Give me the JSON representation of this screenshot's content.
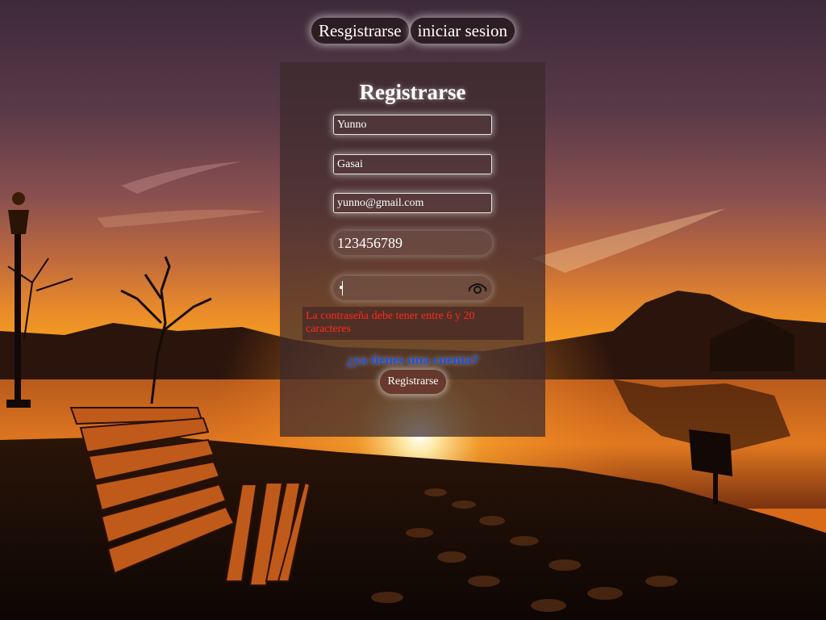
{
  "nav": {
    "register_label": "Resgistrarse",
    "login_label": "iniciar sesion"
  },
  "form": {
    "title": "Registrarse",
    "first_name_value": "Yunno",
    "last_name_value": "Gasai",
    "email_value": "yunno@gmail.com",
    "phone_value": "123456789",
    "password_value": "•",
    "password_toggle_icon": "eye-icon",
    "error_message": "La contraseña debe tener entre 6 y 20 caracteres",
    "have_account_link": "¿ya tienes una cuenta?",
    "submit_label": "Registrarse"
  },
  "colors": {
    "error": "#ff2a1e",
    "link": "#1f4fd8",
    "card_bg": "#3c2a2c"
  }
}
